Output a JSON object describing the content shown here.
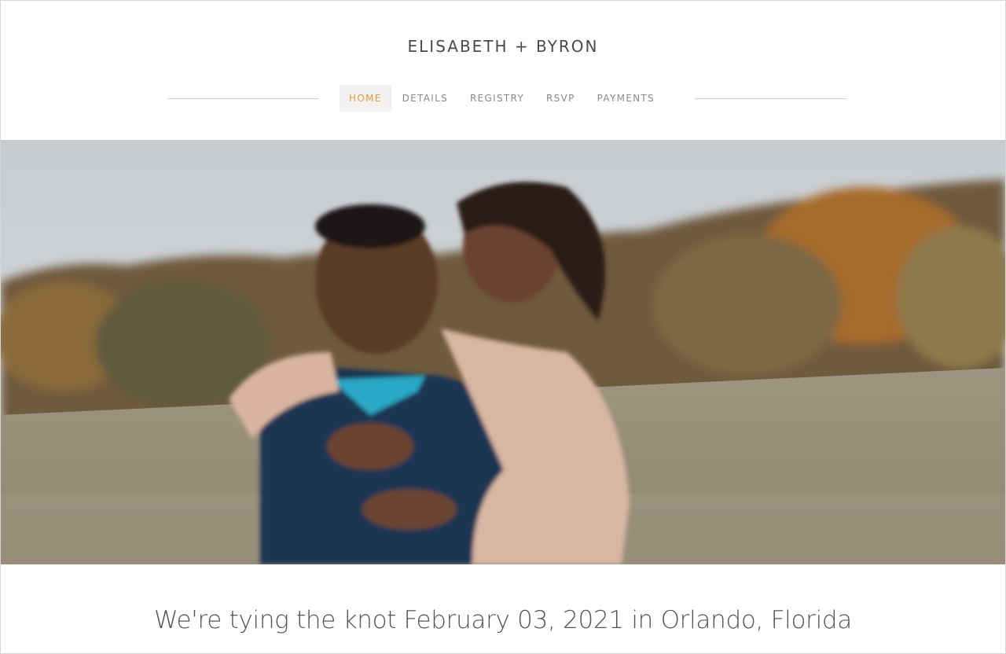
{
  "site": {
    "title": "ELISABETH + BYRON"
  },
  "nav": {
    "items": [
      {
        "label": "HOME",
        "active": true
      },
      {
        "label": "DETAILS",
        "active": false
      },
      {
        "label": "REGISTRY",
        "active": false
      },
      {
        "label": "RSVP",
        "active": false
      },
      {
        "label": "PAYMENTS",
        "active": false
      }
    ]
  },
  "hero": {
    "image_subject": "couple-embracing-in-autumn-field"
  },
  "main": {
    "tagline": "We're tying the knot February 03, 2021 in Orlando, Florida"
  },
  "colors": {
    "accent": "#d7a23a",
    "text": "#4a4a4a",
    "nav_text": "#8a8a8a",
    "active_bg": "#f2f1ef"
  }
}
